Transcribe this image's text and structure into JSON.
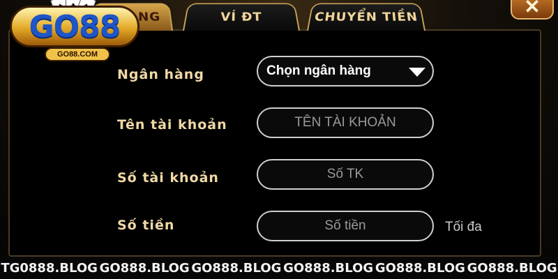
{
  "tabs": [
    {
      "label": "NG",
      "active": true
    },
    {
      "label": "VÍ ĐT",
      "active": false
    },
    {
      "label": "CHUYỂN TIỀN",
      "active": false
    }
  ],
  "close": {
    "icon": "close-icon",
    "glyph": "✕"
  },
  "logo": {
    "text": "GO88",
    "subtext": "GO88.COM"
  },
  "form": {
    "bank": {
      "label": "Ngân hàng",
      "value": "Chọn ngân hàng"
    },
    "account_name": {
      "label": "Tên tài khoản",
      "placeholder": "TÊN TÀI KHOẢN"
    },
    "account_number": {
      "label": "Số tài khoản",
      "placeholder": "Số TK"
    },
    "amount": {
      "label": "Số tiền",
      "placeholder": "Số tiền",
      "max_label": "Tối đa"
    }
  },
  "watermark": [
    "TG0888.BLOG",
    "GO888.BLOG",
    "GO888.BLOG",
    "GO888.BLOG",
    "GO888.BLOG",
    "GO888.BLOG"
  ]
}
